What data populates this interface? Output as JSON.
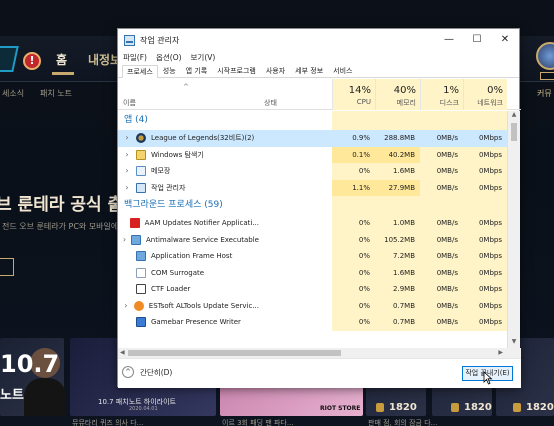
{
  "background_app": {
    "nav": {
      "home": "홈",
      "tab2": "내정보"
    },
    "subnav": [
      "세소식",
      "패치 노트"
    ],
    "headline": "브 룬테라 공식 출",
    "subtext": "전드 오브 룬테라가 PC와 모바일에",
    "card_texts": [
      "10.7 패치노트 하이라이트",
      "2020.04.01"
    ],
    "promo": {
      "number": "10.7",
      "label": "노트"
    },
    "store_label": "RIOT STORE",
    "prices": [
      "1820",
      "1820",
      "1820"
    ],
    "right_label": "커뮤",
    "bottom_texts": [
      "뮤뮤타리 퀴즈 의사 다...",
      "이르 3회 패딩 팬 파다...",
      "판매 점, 회의 잠금 다..."
    ]
  },
  "task_manager": {
    "title": "작업 관리자",
    "window_buttons": {
      "minimize": "—",
      "maximize": "☐",
      "close": "✕"
    },
    "menus": [
      "파일(F)",
      "옵션(O)",
      "보기(V)"
    ],
    "tabs": [
      "프로세스",
      "성능",
      "앱 기록",
      "시작프로그램",
      "사용자",
      "세부 정보",
      "서비스"
    ],
    "active_tab": "프로세스",
    "columns": {
      "name": "이름",
      "status": "상태",
      "cpu": {
        "pct": "14%",
        "label": "CPU"
      },
      "memory": {
        "pct": "40%",
        "label": "메모리"
      },
      "disk": {
        "pct": "1%",
        "label": "디스크"
      },
      "network": {
        "pct": "0%",
        "label": "네트워크"
      }
    },
    "sections": {
      "apps": "앱 (4)",
      "background": "백그라운드 프로세스 (59)"
    },
    "apps": [
      {
        "name": "League of Legends(32비트)(2)",
        "cpu": "0.9%",
        "mem": "288.8MB",
        "disk": "0MB/s",
        "net": "0Mbps",
        "icon": "lol-icon",
        "selected": true
      },
      {
        "name": "Windows 탐색기",
        "cpu": "0.1%",
        "mem": "40.2MB",
        "disk": "0MB/s",
        "net": "0Mbps",
        "icon": "explorer-icon"
      },
      {
        "name": "메모장",
        "cpu": "0%",
        "mem": "1.6MB",
        "disk": "0MB/s",
        "net": "0Mbps",
        "icon": "notepad-icon"
      },
      {
        "name": "작업 관리자",
        "cpu": "1.1%",
        "mem": "27.9MB",
        "disk": "0MB/s",
        "net": "0Mbps",
        "icon": "task-manager-icon"
      }
    ],
    "background": [
      {
        "name": "AAM Updates Notifier Applicati...",
        "cpu": "0%",
        "mem": "1.0MB",
        "disk": "0MB/s",
        "net": "0Mbps",
        "icon": "adobe-icon",
        "expandable": false
      },
      {
        "name": "Antimalware Service Executable",
        "cpu": "0%",
        "mem": "105.2MB",
        "disk": "0MB/s",
        "net": "0Mbps",
        "icon": "service-icon",
        "expandable": true
      },
      {
        "name": "Application Frame Host",
        "cpu": "0%",
        "mem": "7.2MB",
        "disk": "0MB/s",
        "net": "0Mbps",
        "icon": "app-frame-icon",
        "expandable": false
      },
      {
        "name": "COM Surrogate",
        "cpu": "0%",
        "mem": "1.6MB",
        "disk": "0MB/s",
        "net": "0Mbps",
        "icon": "com-icon",
        "expandable": false
      },
      {
        "name": "CTF Loader",
        "cpu": "0%",
        "mem": "2.9MB",
        "disk": "0MB/s",
        "net": "0Mbps",
        "icon": "ctf-icon",
        "expandable": false
      },
      {
        "name": "ESTsoft ALTools Update Servic...",
        "cpu": "0%",
        "mem": "0.7MB",
        "disk": "0MB/s",
        "net": "0Mbps",
        "icon": "estsoft-icon",
        "expandable": true
      },
      {
        "name": "Gamebar Presence Writer",
        "cpu": "0%",
        "mem": "0.7MB",
        "disk": "0MB/s",
        "net": "0Mbps",
        "icon": "gamebar-icon",
        "expandable": false
      }
    ],
    "footer": {
      "fewer_details": "간단히(D)",
      "end_task": "작업 끝내기(E)"
    },
    "colors": {
      "heat": "#fff4c7",
      "heat_hot": "#ffe89a",
      "selected": "#cce8ff",
      "section": "#1a6fb5"
    }
  }
}
